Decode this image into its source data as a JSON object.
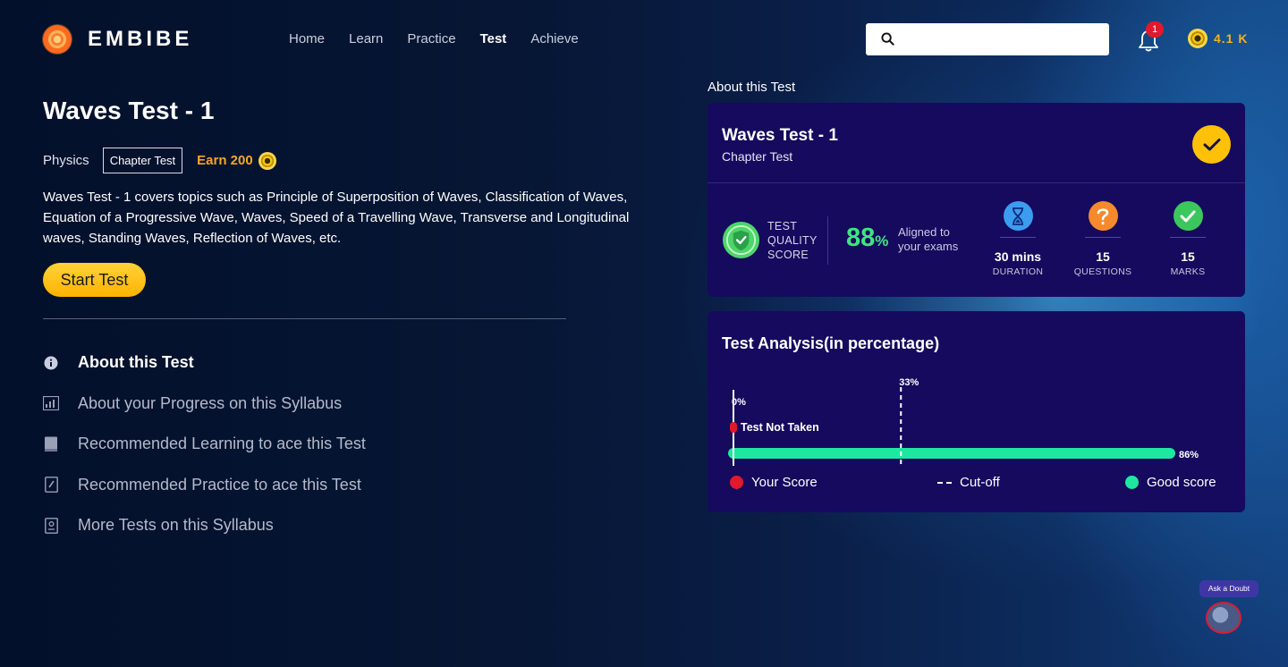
{
  "brand": {
    "name": "EMBIBE"
  },
  "nav": {
    "items": [
      {
        "label": "Home",
        "active": false
      },
      {
        "label": "Learn",
        "active": false
      },
      {
        "label": "Practice",
        "active": false
      },
      {
        "label": "Test",
        "active": true
      },
      {
        "label": "Achieve",
        "active": false
      }
    ]
  },
  "search": {
    "value": "",
    "placeholder": ""
  },
  "notifications": {
    "count": "1"
  },
  "coins": {
    "value": "4.1 K"
  },
  "test": {
    "title": "Waves Test - 1",
    "subject": "Physics",
    "type": "Chapter Test",
    "earn": "Earn 200",
    "description": "Waves Test - 1 covers topics such as Principle of Superposition of Waves, Classification of Waves, Equation of a Progressive Wave, Waves, Speed of a Travelling Wave, Transverse and Longitudinal waves, Standing Waves, Reflection of Waves, etc.",
    "start_label": "Start Test"
  },
  "sections": [
    {
      "label": "About this Test",
      "icon": "info-icon",
      "active": true
    },
    {
      "label": "About your Progress on this Syllabus",
      "icon": "progress-chart-icon",
      "active": false
    },
    {
      "label": "Recommended Learning to ace this Test",
      "icon": "book-icon",
      "active": false
    },
    {
      "label": "Recommended Practice to ace this Test",
      "icon": "practice-sheet-icon",
      "active": false
    },
    {
      "label": "More Tests on this Syllabus",
      "icon": "test-paper-icon",
      "active": false
    }
  ],
  "about": {
    "heading": "About this Test",
    "card_title": "Waves Test - 1",
    "card_subtitle": "Chapter Test",
    "quality_label_1": "TEST",
    "quality_label_2": "QUALITY",
    "quality_label_3": "SCORE",
    "quality_value": "88",
    "quality_unit": "%",
    "aligned_1": "Aligned to",
    "aligned_2": "your exams",
    "stats": [
      {
        "value": "30 mins",
        "label": "DURATION",
        "icon": "hourglass-icon"
      },
      {
        "value": "15",
        "label": "QUESTIONS",
        "icon": "question-icon"
      },
      {
        "value": "15",
        "label": "MARKS",
        "icon": "check-icon"
      }
    ]
  },
  "analysis": {
    "title": "Test Analysis(in percentage)",
    "legend": {
      "your_score": "Your Score",
      "cutoff": "Cut-off",
      "good_score": "Good score"
    },
    "colors": {
      "your_score": "#e0192c",
      "cutoff": "#ffffff",
      "good_score": "#1ee8a0"
    }
  },
  "chart_data": {
    "type": "bar",
    "title": "Test Analysis(in percentage)",
    "xlim": [
      0,
      100
    ],
    "your_score": {
      "value": 0,
      "label": "0%",
      "note": "Test Not Taken"
    },
    "cutoff": {
      "value": 33,
      "label": "33%"
    },
    "good_score": {
      "value": 86,
      "label": "86%"
    }
  },
  "ask_doubt": {
    "label": "Ask a Doubt"
  }
}
